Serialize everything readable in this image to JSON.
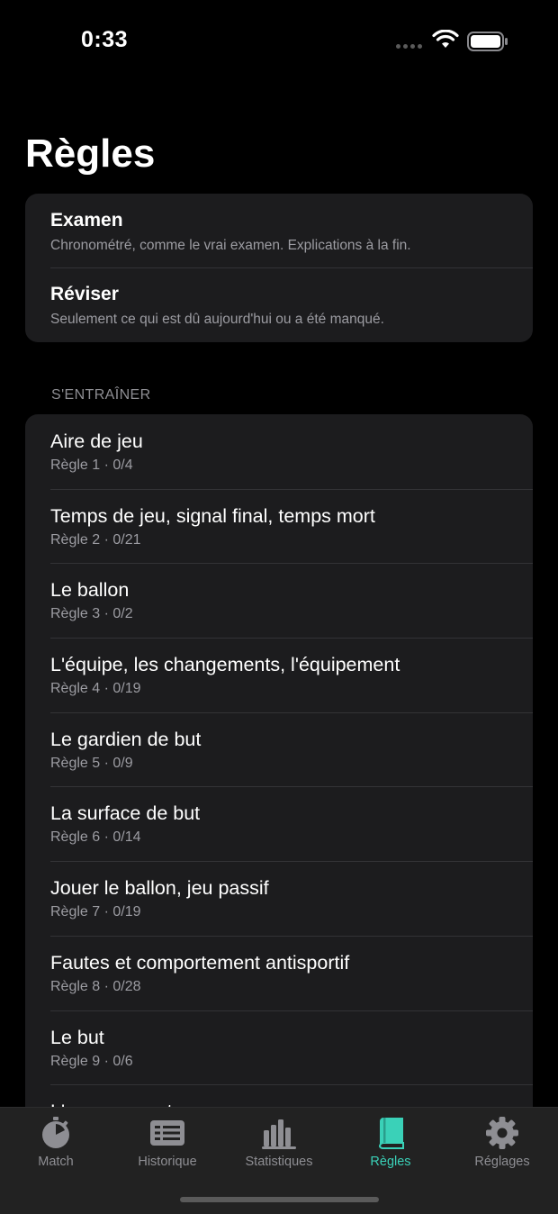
{
  "status_bar": {
    "time": "0:33"
  },
  "page_title": "Règles",
  "modes": [
    {
      "title": "Examen",
      "subtitle": "Chronométré, comme le vrai examen. Explications à la fin."
    },
    {
      "title": "Réviser",
      "subtitle": "Seulement ce qui est dû aujourd'hui ou a été manqué."
    }
  ],
  "section_header": "S'ENTRAÎNER",
  "rules": [
    {
      "title": "Aire de jeu",
      "subtitle": "Règle 1 · 0/4"
    },
    {
      "title": "Temps de jeu, signal final, temps mort",
      "subtitle": "Règle 2 · 0/21"
    },
    {
      "title": "Le ballon",
      "subtitle": "Règle 3 · 0/2"
    },
    {
      "title": "L'équipe, les changements, l'équipement",
      "subtitle": "Règle 4 · 0/19"
    },
    {
      "title": "Le gardien de but",
      "subtitle": "Règle 5 · 0/9"
    },
    {
      "title": "La surface de but",
      "subtitle": "Règle 6 · 0/14"
    },
    {
      "title": "Jouer le ballon, jeu passif",
      "subtitle": "Règle 7 · 0/19"
    },
    {
      "title": "Fautes et comportement antisportif",
      "subtitle": "Règle 8 · 0/28"
    },
    {
      "title": "Le but",
      "subtitle": "Règle 9 · 0/6"
    },
    {
      "title": "L'engagement",
      "subtitle": ""
    }
  ],
  "tabs": [
    {
      "label": "Match",
      "icon": "stopwatch-icon"
    },
    {
      "label": "Historique",
      "icon": "list-icon"
    },
    {
      "label": "Statistiques",
      "icon": "bar-chart-icon"
    },
    {
      "label": "Règles",
      "icon": "book-icon",
      "active": true
    },
    {
      "label": "Réglages",
      "icon": "gear-icon"
    }
  ],
  "colors": {
    "accent": "#3ad1b8",
    "card": "#1c1c1e",
    "background": "#000000",
    "tab_inactive": "#8e8e93"
  }
}
